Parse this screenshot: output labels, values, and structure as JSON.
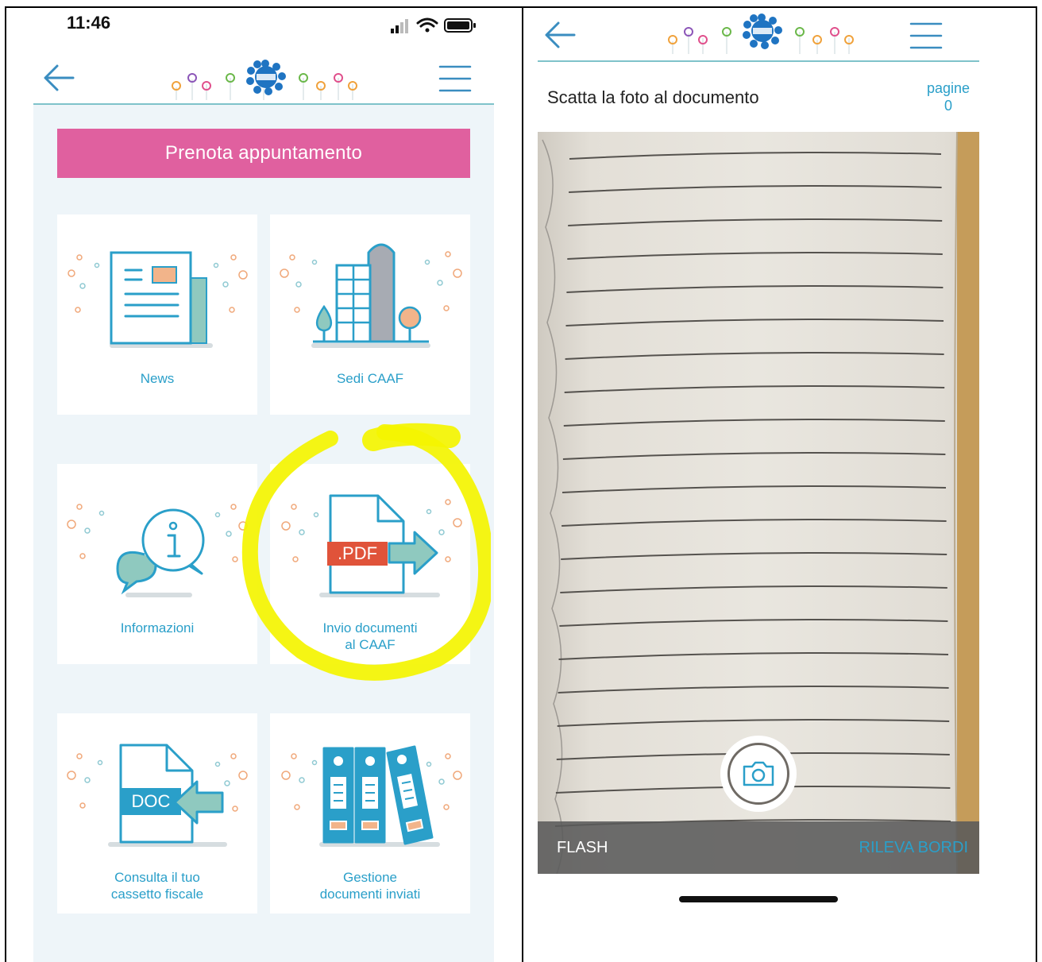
{
  "left_screen": {
    "status_bar": {
      "time": "11:46"
    },
    "prenota_button": "Prenota appuntamento",
    "tiles": [
      {
        "label": "News"
      },
      {
        "label": "Sedi CAAF"
      },
      {
        "label": "Informazioni"
      },
      {
        "label": "Invio documenti",
        "label2": "al CAAF"
      },
      {
        "label": "Consulta il tuo",
        "label2": "cassetto fiscale"
      },
      {
        "label": "Gestione",
        "label2": "documenti inviati"
      }
    ],
    "pdf_tag": ".PDF",
    "doc_tag": "DOC"
  },
  "right_screen": {
    "title": "Scatta la foto al documento",
    "pages_label": "pagine",
    "pages_count": "0",
    "flash_label": "FLASH",
    "edges_label": "RILEVA BORDI"
  },
  "colors": {
    "accent_pink": "#e0609f",
    "accent_blue": "#2a9fc9",
    "header_line": "#7fc3ca",
    "highlight_yellow": "#f4f400",
    "tile_background": "#eef5f9"
  }
}
